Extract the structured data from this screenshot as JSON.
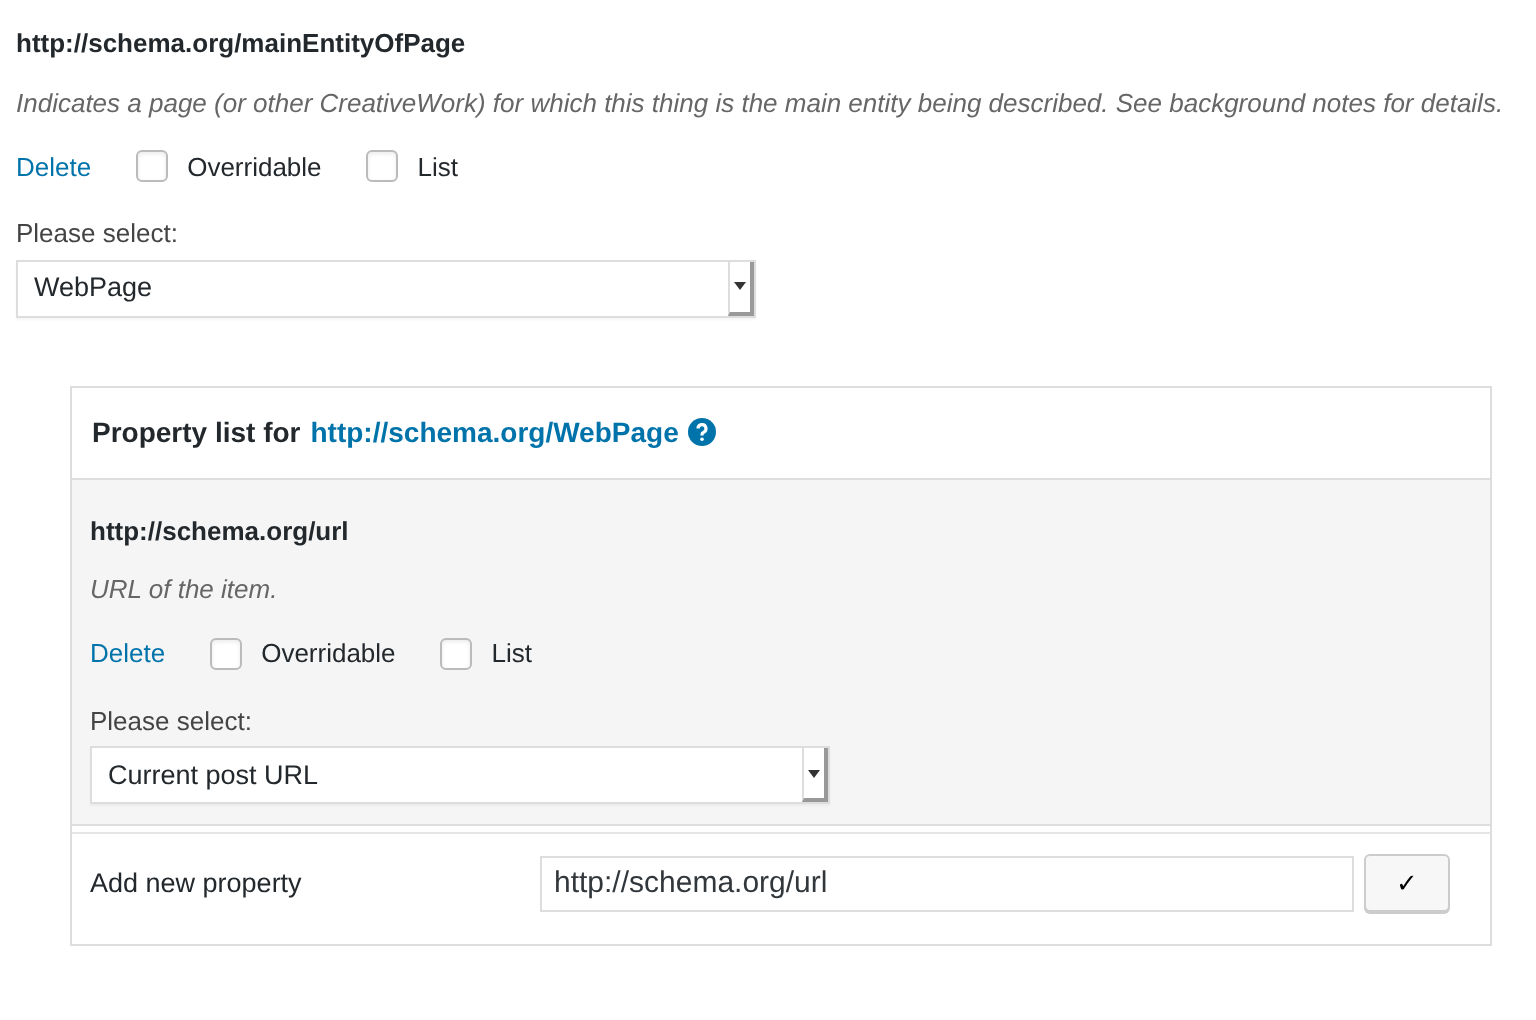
{
  "property": {
    "name": "http://schema.org/mainEntityOfPage",
    "description": "Indicates a page (or other CreativeWork) for which this thing is the main entity being described. See background notes for details.",
    "delete_link": "Delete",
    "checkboxes": [
      {
        "label": "Overridable",
        "checked": false
      },
      {
        "label": "List",
        "checked": false
      }
    ],
    "select_label": "Please select:",
    "select_value": "WebPage"
  },
  "panel": {
    "title": "Property list for",
    "type_link": "http://schema.org/WebPage",
    "property": {
      "name": "http://schema.org/url",
      "description": "URL of the item.",
      "delete_link": "Delete",
      "checkboxes": [
        {
          "label": "Overridable",
          "checked": false
        },
        {
          "label": "List",
          "checked": false
        }
      ],
      "select_label": "Please select:",
      "select_value": "Current post URL"
    },
    "add_label": "Add new property",
    "add_value": "http://schema.org/url",
    "add_button": "✓"
  }
}
